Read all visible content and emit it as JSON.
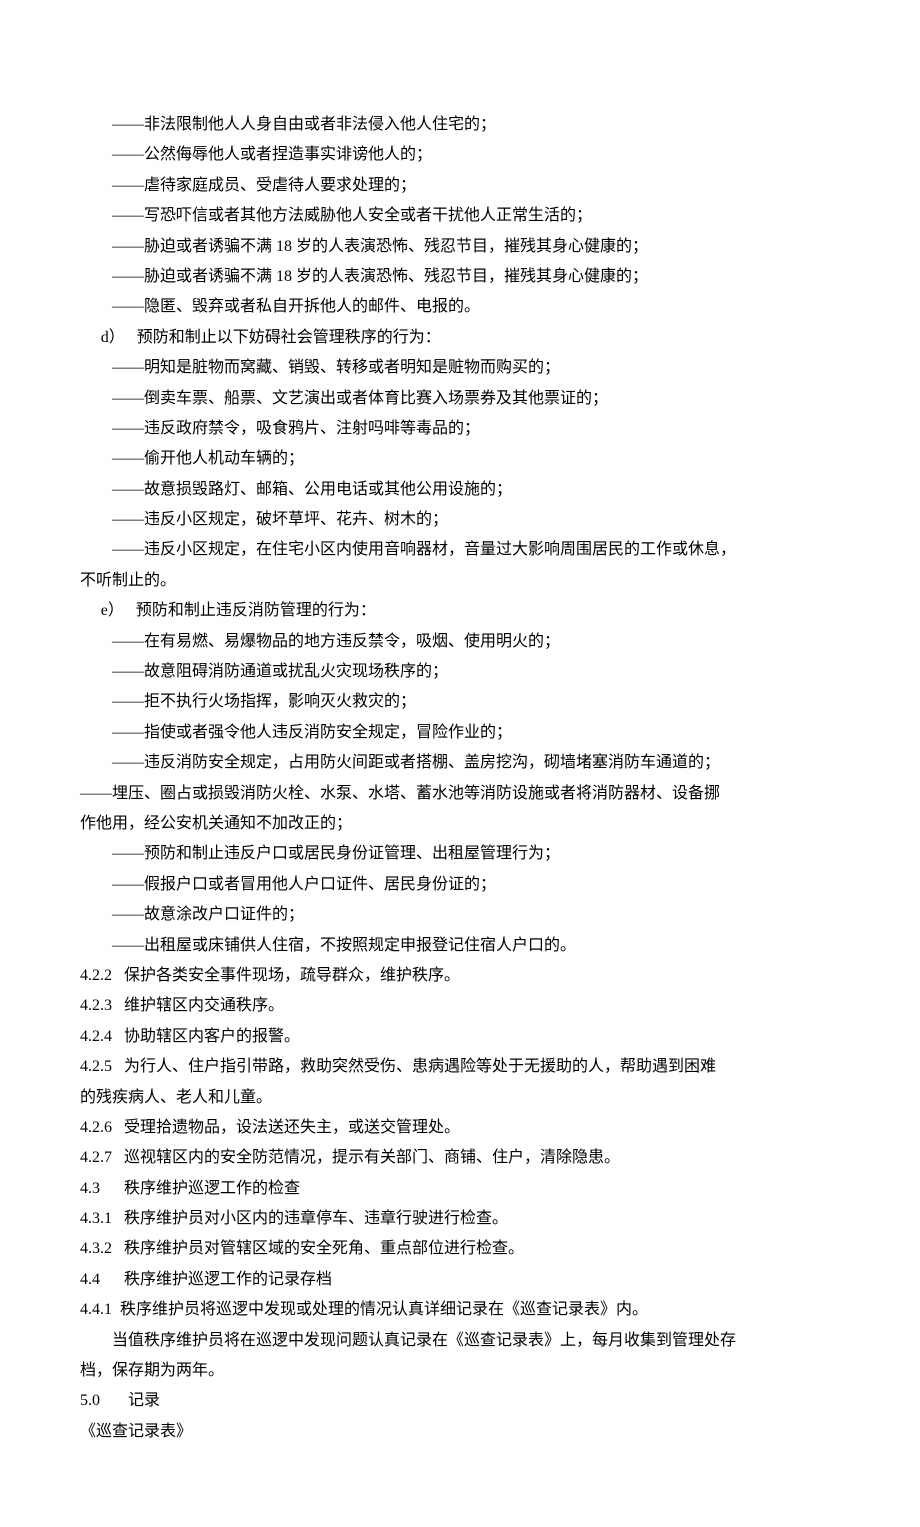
{
  "lines": [
    {
      "cls": "indent-2",
      "text": "——非法限制他人人身自由或者非法侵入他人住宅的；"
    },
    {
      "cls": "indent-2",
      "text": "——公然侮辱他人或者捏造事实诽谤他人的；"
    },
    {
      "cls": "indent-2",
      "text": "——虐待家庭成员、受虐待人要求处理的；"
    },
    {
      "cls": "indent-2",
      "text": "——写恐吓信或者其他方法威胁他人安全或者干扰他人正常生活的；"
    },
    {
      "cls": "indent-2",
      "text": "——胁迫或者诱骗不满 18 岁的人表演恐怖、残忍节目，摧残其身心健康的；"
    },
    {
      "cls": "indent-2",
      "text": "——胁迫或者诱骗不满 18 岁的人表演恐怖、残忍节目，摧残其身心健康的；"
    },
    {
      "cls": "indent-2",
      "text": "——隐匿、毁弃或者私自开拆他人的邮件、电报的。"
    },
    {
      "cls": "indent-label",
      "text": "d）   预防和制止以下妨碍社会管理秩序的行为："
    },
    {
      "cls": "indent-2",
      "text": "——明知是脏物而窝藏、销毁、转移或者明知是赃物而购买的；"
    },
    {
      "cls": "indent-2",
      "text": "——倒卖车票、船票、文艺演出或者体育比赛入场票券及其他票证的；"
    },
    {
      "cls": "indent-2",
      "text": "——违反政府禁令，吸食鸦片、注射吗啡等毒品的；"
    },
    {
      "cls": "indent-2",
      "text": "——偷开他人机动车辆的；"
    },
    {
      "cls": "indent-2",
      "text": "——故意损毁路灯、邮箱、公用电话或其他公用设施的；"
    },
    {
      "cls": "indent-2",
      "text": "——违反小区规定，破坏草坪、花卉、树木的；"
    },
    {
      "cls": "indent-2",
      "text": "——违反小区规定，在住宅小区内使用音响器材，音量过大影响周围居民的工作或休息，"
    },
    {
      "cls": "no-indent",
      "text": "不听制止的。"
    },
    {
      "cls": "indent-label",
      "text": "e）   预防和制止违反消防管理的行为："
    },
    {
      "cls": "indent-2",
      "text": "——在有易燃、易爆物品的地方违反禁令，吸烟、使用明火的；"
    },
    {
      "cls": "indent-2",
      "text": "——故意阻碍消防通道或扰乱火灾现场秩序的；"
    },
    {
      "cls": "indent-2",
      "text": "——拒不执行火场指挥，影响灭火救灾的；"
    },
    {
      "cls": "indent-2",
      "text": "——指使或者强令他人违反消防安全规定，冒险作业的；"
    },
    {
      "cls": "indent-2",
      "text": "——违反消防安全规定，占用防火间距或者搭棚、盖房挖沟，砌墙堵塞消防车通道的；"
    },
    {
      "cls": "no-indent",
      "text": "——埋压、圈占或损毁消防火栓、水泵、水塔、蓄水池等消防设施或者将消防器材、设备挪"
    },
    {
      "cls": "no-indent",
      "text": "作他用，经公安机关通知不加改正的；"
    },
    {
      "cls": "indent-2",
      "text": "——预防和制止违反户口或居民身份证管理、出租屋管理行为；"
    },
    {
      "cls": "indent-2",
      "text": "——假报户口或者冒用他人户口证件、居民身份证的；"
    },
    {
      "cls": "indent-2",
      "text": "——故意涂改户口证件的；"
    },
    {
      "cls": "indent-2",
      "text": "——出租屋或床铺供人住宿，不按照规定申报登记住宿人户口的。"
    },
    {
      "cls": "no-indent",
      "text": "4.2.2   保护各类安全事件现场，疏导群众，维护秩序。"
    },
    {
      "cls": "no-indent",
      "text": "4.2.3   维护辖区内交通秩序。"
    },
    {
      "cls": "no-indent",
      "text": "4.2.4   协助辖区内客户的报警。"
    },
    {
      "cls": "no-indent",
      "text": "4.2.5   为行人、住户指引带路，救助突然受伤、患病遇险等处于无援助的人，帮助遇到困难"
    },
    {
      "cls": "no-indent",
      "text": "的残疾病人、老人和儿童。"
    },
    {
      "cls": "no-indent",
      "text": "4.2.6   受理拾遗物品，设法送还失主，或送交管理处。"
    },
    {
      "cls": "no-indent",
      "text": "4.2.7   巡视辖区内的安全防范情况，提示有关部门、商铺、住户，清除隐患。"
    },
    {
      "cls": "no-indent",
      "text": "4.3      秩序维护巡逻工作的检查"
    },
    {
      "cls": "no-indent",
      "text": "4.3.1   秩序维护员对小区内的违章停车、违章行驶进行检查。"
    },
    {
      "cls": "no-indent",
      "text": "4.3.2   秩序维护员对管辖区域的安全死角、重点部位进行检查。"
    },
    {
      "cls": "no-indent",
      "text": "4.4      秩序维护巡逻工作的记录存档"
    },
    {
      "cls": "no-indent",
      "text": "4.4.1  秩序维护员将巡逻中发现或处理的情况认真详细记录在《巡查记录表》内。"
    },
    {
      "cls": "indent-2",
      "text": "当值秩序维护员将在巡逻中发现问题认真记录在《巡查记录表》上，每月收集到管理处存"
    },
    {
      "cls": "no-indent",
      "text": "档，保存期为两年。"
    },
    {
      "cls": "no-indent",
      "text": "5.0       记录"
    },
    {
      "cls": "no-indent",
      "text": "《巡查记录表》"
    }
  ]
}
